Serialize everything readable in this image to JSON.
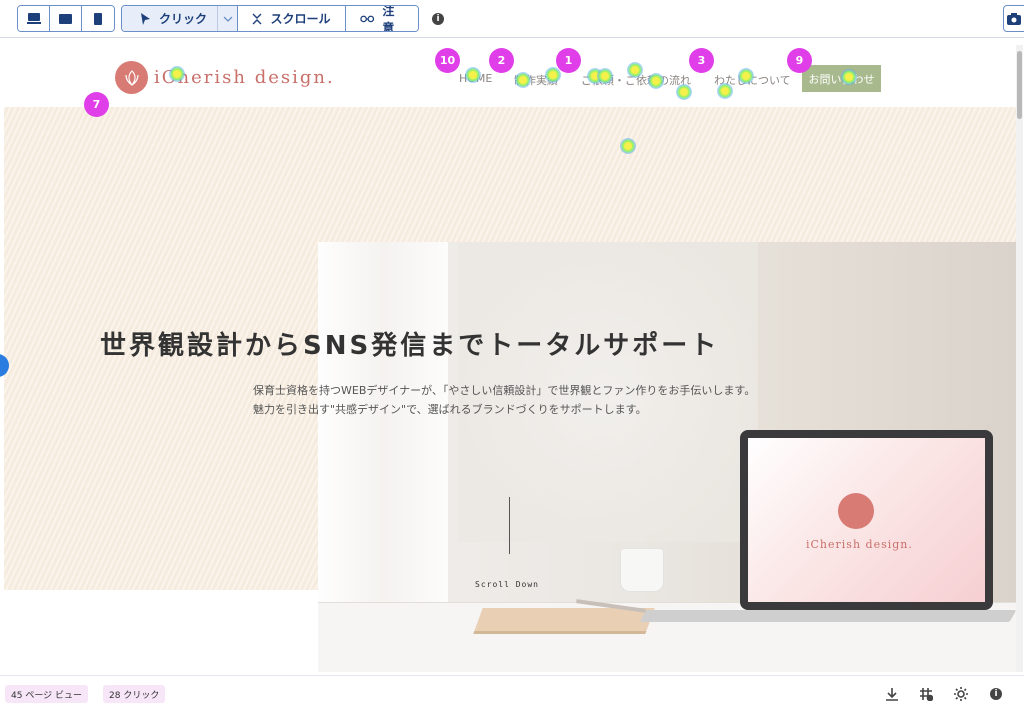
{
  "toolbar": {
    "modes": {
      "click": "クリック",
      "scroll": "スクロール",
      "attention": "注意"
    },
    "info_icon_glyph": "i"
  },
  "site": {
    "logo_text": "iCherish design.",
    "nav": [
      {
        "key": "home",
        "label": "HOME"
      },
      {
        "key": "works",
        "label": "制作実績"
      },
      {
        "key": "flow",
        "label": "ご依頼・ご依頼の流れ"
      },
      {
        "key": "about",
        "label": "わたしについて"
      }
    ],
    "cta": "お問い合わせ",
    "hero_title": "世界観設計からSNS発信までトータルサポート",
    "hero_sub_1": "保育士資格を持つWEBデザイナーが、「やさしい信頼設計」で世界観とファン作りをお手伝いします。",
    "hero_sub_2": "魅力を引き出す\"共感デザイン\"で、選ばれるブランドづくりをサポートします。",
    "scroll_down": "Scroll Down",
    "laptop_logo_text": "iCherish design."
  },
  "heatmap": {
    "badges": [
      "10",
      "2",
      "1",
      "3",
      "9",
      "7"
    ],
    "colors": {
      "badge": "#e03ee8",
      "hot": "#f5f04a",
      "warm": "#8ef26b",
      "cool": "#5aaaff"
    }
  },
  "stats": {
    "pageviews": "45 ページ ビュー",
    "clicks": "28 クリック"
  },
  "icons": [
    "desktop-icon",
    "tablet-icon",
    "mobile-icon",
    "cursor-icon",
    "chevron-down-icon",
    "scroll-icon",
    "glasses-icon",
    "info-icon",
    "camera-icon",
    "download-icon",
    "grid-off-icon",
    "brightness-icon"
  ]
}
